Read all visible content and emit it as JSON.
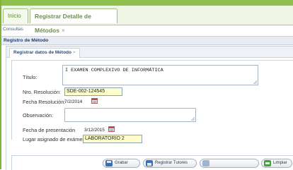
{
  "main_tabs": [
    {
      "label": "Inicio"
    },
    {
      "label": "Registrar Detalle de Métodos",
      "close": "×"
    }
  ],
  "breadcrumb": "Consultas",
  "section_title": "Registro de Método",
  "sub_tab": {
    "label": "Registrar datos de Método",
    "close": "×"
  },
  "form": {
    "titulo_label": "Título:",
    "titulo_value": "I EXAMEN COMPLEXIVO DE INFORMÁTICA",
    "resolucion_label": "Nro. Resolución:",
    "resolucion_value": "SDE-002-124545",
    "fecha_resolucion_label": "Fecha Resolución:",
    "fecha_resolucion_value": "7/2/2014",
    "observacion_label": "Observación:",
    "observacion_value": "",
    "fecha_presentacion_label": "Fecha de presentación",
    "fecha_presentacion_value": "3/12/2015",
    "lugar_label": "Lugar asignado de exámen",
    "lugar_value": "LABORATORIO 2"
  },
  "buttons": {
    "grabar": "Grabar",
    "registrar_tutores": "Registrar Tutores",
    "disabled": "",
    "limpiar": "Limpiar"
  },
  "colors": {
    "accent_green": "#8cc04a",
    "highlight_field": "#ffffcc",
    "title_blue": "#243e6b"
  }
}
